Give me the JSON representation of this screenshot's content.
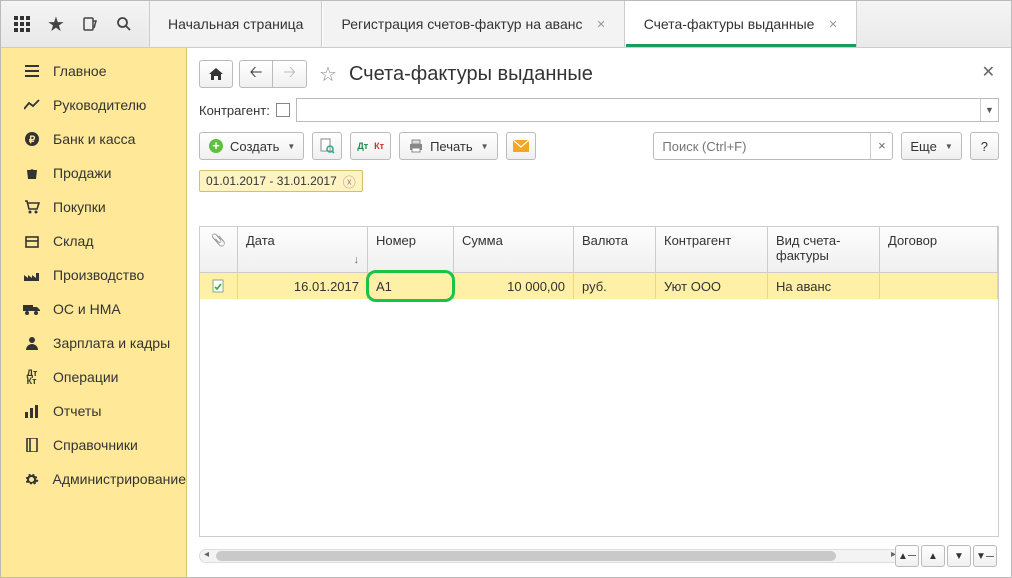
{
  "topbar": {
    "tabs": [
      {
        "label": "Начальная страница",
        "closable": false
      },
      {
        "label": "Регистрация счетов-фактур на аванс",
        "closable": true
      },
      {
        "label": "Счета-фактуры выданные",
        "closable": true,
        "active": true
      }
    ]
  },
  "sidebar": {
    "items": [
      {
        "label": "Главное",
        "icon": "menu-lines-icon"
      },
      {
        "label": "Руководителю",
        "icon": "chart-line-icon"
      },
      {
        "label": "Банк и касса",
        "icon": "ruble-circle-icon"
      },
      {
        "label": "Продажи",
        "icon": "bag-icon"
      },
      {
        "label": "Покупки",
        "icon": "cart-icon"
      },
      {
        "label": "Склад",
        "icon": "box-icon"
      },
      {
        "label": "Производство",
        "icon": "factory-icon"
      },
      {
        "label": "ОС и НМА",
        "icon": "truck-icon"
      },
      {
        "label": "Зарплата и кадры",
        "icon": "person-icon"
      },
      {
        "label": "Операции",
        "icon": "dtkt-icon"
      },
      {
        "label": "Отчеты",
        "icon": "bars-icon"
      },
      {
        "label": "Справочники",
        "icon": "book-icon"
      },
      {
        "label": "Администрирование",
        "icon": "gear-icon"
      }
    ]
  },
  "page": {
    "title": "Счета-фактуры выданные",
    "counterparty_label": "Контрагент:",
    "create_label": "Создать",
    "print_label": "Печать",
    "more_label": "Еще",
    "help_label": "?",
    "search_placeholder": "Поиск (Ctrl+F)",
    "date_filter": "01.01.2017 - 31.01.2017"
  },
  "grid": {
    "columns": [
      "",
      "Дата",
      "Номер",
      "Сумма",
      "Валюта",
      "Контрагент",
      "Вид счета-фактуры",
      "Договор"
    ],
    "rows": [
      {
        "attach_icon": "doc-check-icon",
        "date": "16.01.2017",
        "number": "А1",
        "sum": "10 000,00",
        "currency": "руб.",
        "counterparty": "Уют ООО",
        "type": "На аванс",
        "contract": ""
      }
    ],
    "attach_header": "📎"
  }
}
